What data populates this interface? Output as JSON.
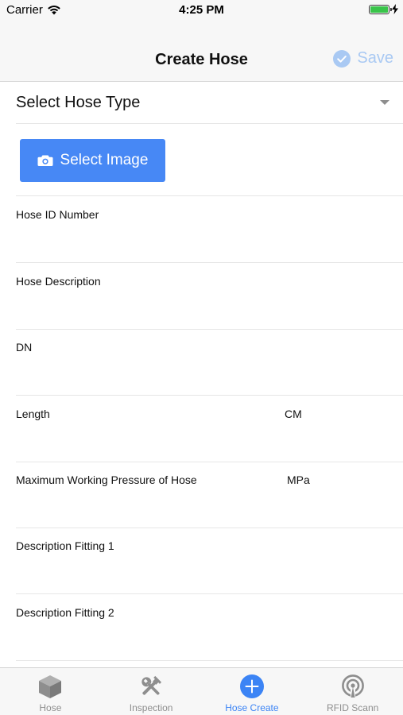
{
  "status_bar": {
    "carrier": "Carrier",
    "time": "4:25 PM",
    "battery_color": "#39c44a"
  },
  "nav": {
    "title": "Create Hose",
    "save_label": "Save",
    "save_color": "#a9c9f3"
  },
  "hose_type": {
    "label": "Select Hose Type",
    "icon": "caret-down-icon"
  },
  "select_image": {
    "label": "Select Image",
    "icon": "camera-icon",
    "color": "#4788f5"
  },
  "fields": [
    {
      "label": "Hose ID Number",
      "value": "",
      "unit": ""
    },
    {
      "label": "Hose Description",
      "value": "",
      "unit": ""
    },
    {
      "label": "DN",
      "value": "",
      "unit": ""
    },
    {
      "label": "Length",
      "value": "",
      "unit": "CM"
    },
    {
      "label": "Maximum Working Pressure of Hose",
      "value": "",
      "unit": "MPa"
    },
    {
      "label": "Description Fitting 1",
      "value": "",
      "unit": ""
    },
    {
      "label": "Description Fitting 2",
      "value": "",
      "unit": ""
    }
  ],
  "tabs": [
    {
      "label": "Hose",
      "icon": "cube-icon",
      "active": false
    },
    {
      "label": "Inspection",
      "icon": "tools-icon",
      "active": false
    },
    {
      "label": "Hose Create",
      "icon": "plus-circle-icon",
      "active": true
    },
    {
      "label": "RFID Scann",
      "icon": "rfid-icon",
      "active": false
    }
  ],
  "accent_color": "#3c84f5"
}
